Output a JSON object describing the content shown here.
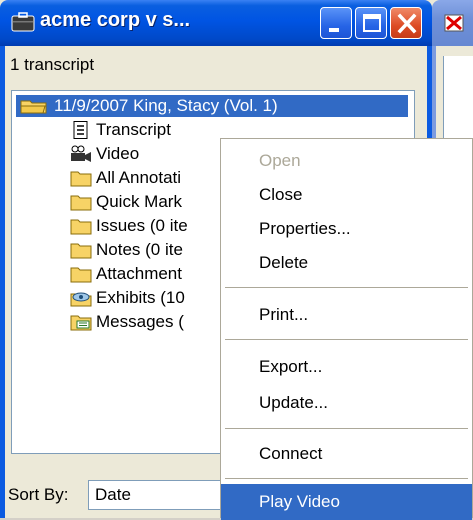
{
  "window": {
    "title": "acme corp v s...",
    "transcript_count": "1 transcript"
  },
  "tree": {
    "selected_item": "11/9/2007    King, Stacy  (Vol. 1)",
    "items": [
      {
        "label": "Transcript",
        "icon": "transcript-icon"
      },
      {
        "label": "Video",
        "icon": "video-icon"
      },
      {
        "label": "All Annotati",
        "icon": "folder-icon"
      },
      {
        "label": "Quick Mark",
        "icon": "folder-icon"
      },
      {
        "label": "Issues (0 ite",
        "icon": "folder-icon"
      },
      {
        "label": "Notes (0 ite",
        "icon": "folder-icon"
      },
      {
        "label": "Attachment",
        "icon": "folder-icon"
      },
      {
        "label": "Exhibits (10",
        "icon": "exhibits-icon"
      },
      {
        "label": "Messages (",
        "icon": "messages-icon"
      }
    ]
  },
  "sort": {
    "label": "Sort By:",
    "value": "Date"
  },
  "context_menu": {
    "items": [
      {
        "label": "Open",
        "state": "disabled"
      },
      {
        "label": "Close"
      },
      {
        "label": "Properties..."
      },
      {
        "label": "Delete"
      },
      {
        "label": "Print..."
      },
      {
        "label": "Export..."
      },
      {
        "label": "Update..."
      },
      {
        "label": "Connect"
      },
      {
        "label": "Play Video",
        "state": "highlighted"
      }
    ]
  },
  "colors": {
    "titlebar": "#0054e3",
    "selection": "#316ac5",
    "menu_disabled_text": "#aca899",
    "close_button": "#dd4b24"
  }
}
